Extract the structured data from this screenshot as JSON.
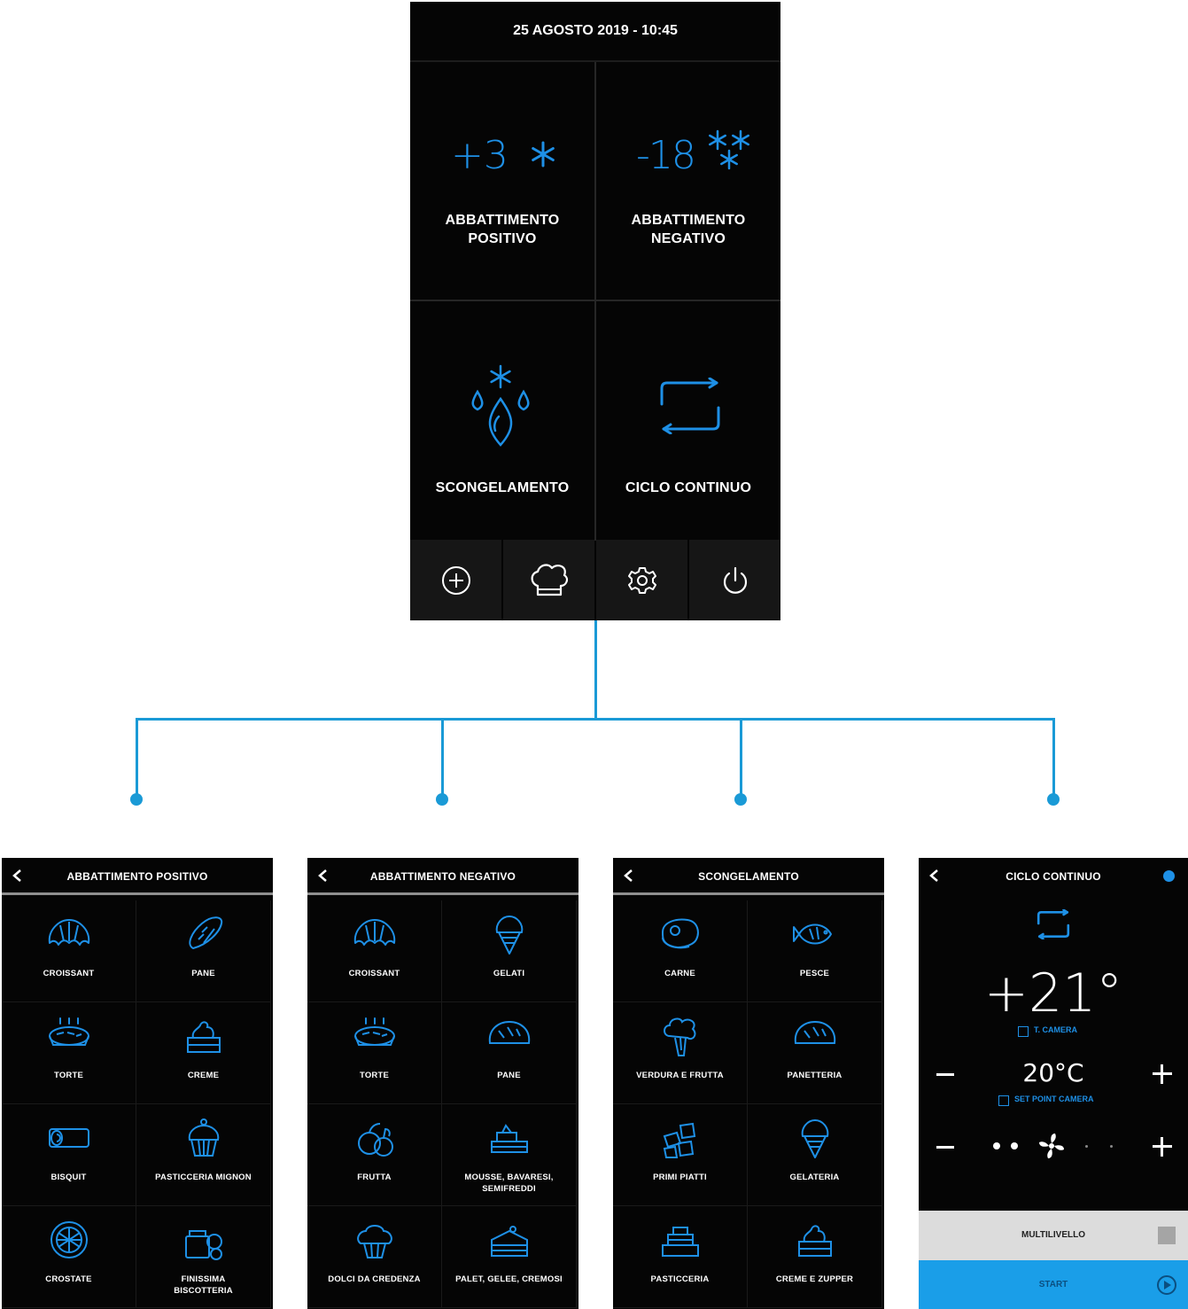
{
  "main": {
    "datetime": "25 AGOSTO 2019 - 10:45",
    "tiles": [
      {
        "icon_text": "+3",
        "label_lines": [
          "ABBATTIMENTO",
          "POSITIVO"
        ]
      },
      {
        "icon_text": "-18",
        "label_lines": [
          "ABBATTIMENTO",
          "NEGATIVO"
        ]
      },
      {
        "label": "SCONGELAMENTO"
      },
      {
        "label": "CICLO CONTINUO"
      }
    ],
    "footer_icons": [
      "add-circle-icon",
      "chef-hat-icon",
      "gear-icon",
      "power-icon"
    ]
  },
  "abbattimento_positivo": {
    "title": "ABBATTIMENTO POSITIVO",
    "items": [
      {
        "label": "CROISSANT",
        "icon": "croissant-icon"
      },
      {
        "label": "PANE",
        "icon": "bread-icon"
      },
      {
        "label": "TORTE",
        "icon": "pie-icon"
      },
      {
        "label": "CREME",
        "icon": "cream-cake-icon"
      },
      {
        "label": "BISQUIT",
        "icon": "sponge-roll-icon"
      },
      {
        "label": "PASTICCERIA MIGNON",
        "icon": "cupcake-icon"
      },
      {
        "label": "CROSTATE",
        "icon": "tart-icon"
      },
      {
        "label": "FINISSIMA",
        "label2": "BISCOTTERIA",
        "icon": "cookie-jar-icon"
      }
    ]
  },
  "abbattimento_negativo": {
    "title": "ABBATTIMENTO NEGATIVO",
    "items": [
      {
        "label": "CROISSANT",
        "icon": "croissant-icon"
      },
      {
        "label": "GELATI",
        "icon": "ice-cream-icon"
      },
      {
        "label": "TORTE",
        "icon": "pie-icon"
      },
      {
        "label": "PANE",
        "icon": "bread-loaf-icon"
      },
      {
        "label": "FRUTTA",
        "icon": "fruit-icon"
      },
      {
        "label": "MOUSSE, BAVARESI,",
        "label2": "SEMIFREDDI",
        "icon": "mousse-icon"
      },
      {
        "label": "DOLCI DA CREDENZA",
        "icon": "muffin-icon"
      },
      {
        "label": "PALET, GELEE, CREMOSI",
        "icon": "layer-cake-icon"
      }
    ]
  },
  "scongelamento": {
    "title": "SCONGELAMENTO",
    "items": [
      {
        "label": "CARNE",
        "icon": "steak-icon"
      },
      {
        "label": "PESCE",
        "icon": "fish-icon"
      },
      {
        "label": "VERDURA E FRUTTA",
        "icon": "vegetables-icon"
      },
      {
        "label": "PANETTERIA",
        "icon": "bread-loaf-icon"
      },
      {
        "label": "PRIMI PIATTI",
        "icon": "ice-cubes-icon"
      },
      {
        "label": "GELATERIA",
        "icon": "ice-cream-icon"
      },
      {
        "label": "PASTICCERIA",
        "icon": "pastry-icon"
      },
      {
        "label": "CREME E ZUPPER",
        "icon": "cream-cake-icon"
      }
    ]
  },
  "ciclo_continuo": {
    "title": "CICLO CONTINUO",
    "temperature": "+21°",
    "temperature_label": "T. CAMERA",
    "setpoint": "20°C",
    "setpoint_label": "SET POINT CAMERA",
    "fan_level": 2,
    "fan_levels_total": 4,
    "multilevel_label": "MULTILIVELLO",
    "start_label": "START"
  },
  "colors": {
    "accent": "#1e90e6",
    "connector": "#1a9ad6",
    "background": "#050505"
  }
}
